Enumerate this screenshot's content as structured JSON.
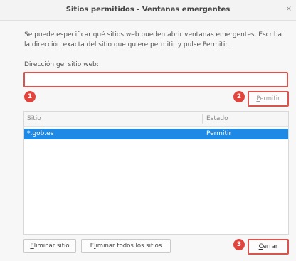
{
  "window": {
    "title": "Sitios permitidos - Ventanas emergentes",
    "close_glyph": "×"
  },
  "description": "Se puede especificar qué sitios web pueden abrir ventanas emergentes. Escriba la dirección exacta del sitio que quiere permitir y pulse Permitir.",
  "address": {
    "label_prefix": "Dirección ",
    "label_underlined": "g",
    "label_suffix": "el sitio web:",
    "value": ""
  },
  "badges": {
    "one": "1",
    "two": "2",
    "three": "3"
  },
  "buttons": {
    "permit_prefix": "",
    "permit_underlined": "P",
    "permit_suffix": "ermitir",
    "remove_prefix": "",
    "remove_underlined": "E",
    "remove_suffix": "liminar sitio",
    "remove_all_prefix": "E",
    "remove_all_underlined": "l",
    "remove_all_suffix": "iminar todos los sitios",
    "close_prefix": "",
    "close_underlined": "C",
    "close_suffix": "errar"
  },
  "table": {
    "columns": [
      "Sitio",
      "Estado"
    ],
    "rows": [
      {
        "site": "*.gob.es",
        "status": "Permitir",
        "selected": true
      }
    ]
  },
  "colors": {
    "annotation_red": "#e0443c",
    "selection_blue": "#1e8ae6"
  }
}
